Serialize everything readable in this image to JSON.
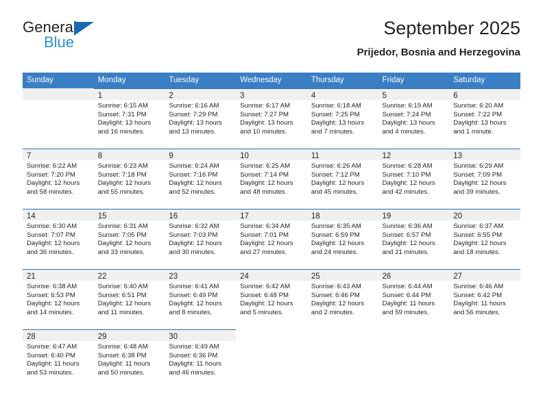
{
  "brand": {
    "line1": "General",
    "line2": "Blue",
    "triangle_color": "#1b68b3",
    "blue_text_color": "#2e8fd6"
  },
  "header": {
    "title": "September 2025",
    "subtitle": "Prijedor, Bosnia and Herzegovina",
    "header_bg_color": "#3a7ec4",
    "header_text_color": "#ffffff",
    "datebar_bg_color": "#f0f0f0",
    "rule_color": "#2f6fae"
  },
  "weekdays": [
    "Sunday",
    "Monday",
    "Tuesday",
    "Wednesday",
    "Thursday",
    "Friday",
    "Saturday"
  ],
  "weeks": [
    [
      {
        "day": "",
        "lines": []
      },
      {
        "day": "1",
        "lines": [
          "Sunrise: 6:15 AM",
          "Sunset: 7:31 PM",
          "Daylight: 13 hours",
          "and 16 minutes."
        ]
      },
      {
        "day": "2",
        "lines": [
          "Sunrise: 6:16 AM",
          "Sunset: 7:29 PM",
          "Daylight: 13 hours",
          "and 13 minutes."
        ]
      },
      {
        "day": "3",
        "lines": [
          "Sunrise: 6:17 AM",
          "Sunset: 7:27 PM",
          "Daylight: 13 hours",
          "and 10 minutes."
        ]
      },
      {
        "day": "4",
        "lines": [
          "Sunrise: 6:18 AM",
          "Sunset: 7:25 PM",
          "Daylight: 13 hours",
          "and 7 minutes."
        ]
      },
      {
        "day": "5",
        "lines": [
          "Sunrise: 6:19 AM",
          "Sunset: 7:24 PM",
          "Daylight: 13 hours",
          "and 4 minutes."
        ]
      },
      {
        "day": "6",
        "lines": [
          "Sunrise: 6:20 AM",
          "Sunset: 7:22 PM",
          "Daylight: 13 hours",
          "and 1 minute."
        ]
      }
    ],
    [
      {
        "day": "7",
        "lines": [
          "Sunrise: 6:22 AM",
          "Sunset: 7:20 PM",
          "Daylight: 12 hours",
          "and 58 minutes."
        ]
      },
      {
        "day": "8",
        "lines": [
          "Sunrise: 6:23 AM",
          "Sunset: 7:18 PM",
          "Daylight: 12 hours",
          "and 55 minutes."
        ]
      },
      {
        "day": "9",
        "lines": [
          "Sunrise: 6:24 AM",
          "Sunset: 7:16 PM",
          "Daylight: 12 hours",
          "and 52 minutes."
        ]
      },
      {
        "day": "10",
        "lines": [
          "Sunrise: 6:25 AM",
          "Sunset: 7:14 PM",
          "Daylight: 12 hours",
          "and 48 minutes."
        ]
      },
      {
        "day": "11",
        "lines": [
          "Sunrise: 6:26 AM",
          "Sunset: 7:12 PM",
          "Daylight: 12 hours",
          "and 45 minutes."
        ]
      },
      {
        "day": "12",
        "lines": [
          "Sunrise: 6:28 AM",
          "Sunset: 7:10 PM",
          "Daylight: 12 hours",
          "and 42 minutes."
        ]
      },
      {
        "day": "13",
        "lines": [
          "Sunrise: 6:29 AM",
          "Sunset: 7:09 PM",
          "Daylight: 12 hours",
          "and 39 minutes."
        ]
      }
    ],
    [
      {
        "day": "14",
        "lines": [
          "Sunrise: 6:30 AM",
          "Sunset: 7:07 PM",
          "Daylight: 12 hours",
          "and 36 minutes."
        ]
      },
      {
        "day": "15",
        "lines": [
          "Sunrise: 6:31 AM",
          "Sunset: 7:05 PM",
          "Daylight: 12 hours",
          "and 33 minutes."
        ]
      },
      {
        "day": "16",
        "lines": [
          "Sunrise: 6:32 AM",
          "Sunset: 7:03 PM",
          "Daylight: 12 hours",
          "and 30 minutes."
        ]
      },
      {
        "day": "17",
        "lines": [
          "Sunrise: 6:34 AM",
          "Sunset: 7:01 PM",
          "Daylight: 12 hours",
          "and 27 minutes."
        ]
      },
      {
        "day": "18",
        "lines": [
          "Sunrise: 6:35 AM",
          "Sunset: 6:59 PM",
          "Daylight: 12 hours",
          "and 24 minutes."
        ]
      },
      {
        "day": "19",
        "lines": [
          "Sunrise: 6:36 AM",
          "Sunset: 6:57 PM",
          "Daylight: 12 hours",
          "and 21 minutes."
        ]
      },
      {
        "day": "20",
        "lines": [
          "Sunrise: 6:37 AM",
          "Sunset: 6:55 PM",
          "Daylight: 12 hours",
          "and 18 minutes."
        ]
      }
    ],
    [
      {
        "day": "21",
        "lines": [
          "Sunrise: 6:38 AM",
          "Sunset: 6:53 PM",
          "Daylight: 12 hours",
          "and 14 minutes."
        ]
      },
      {
        "day": "22",
        "lines": [
          "Sunrise: 6:40 AM",
          "Sunset: 6:51 PM",
          "Daylight: 12 hours",
          "and 11 minutes."
        ]
      },
      {
        "day": "23",
        "lines": [
          "Sunrise: 6:41 AM",
          "Sunset: 6:49 PM",
          "Daylight: 12 hours",
          "and 8 minutes."
        ]
      },
      {
        "day": "24",
        "lines": [
          "Sunrise: 6:42 AM",
          "Sunset: 6:48 PM",
          "Daylight: 12 hours",
          "and 5 minutes."
        ]
      },
      {
        "day": "25",
        "lines": [
          "Sunrise: 6:43 AM",
          "Sunset: 6:46 PM",
          "Daylight: 12 hours",
          "and 2 minutes."
        ]
      },
      {
        "day": "26",
        "lines": [
          "Sunrise: 6:44 AM",
          "Sunset: 6:44 PM",
          "Daylight: 11 hours",
          "and 59 minutes."
        ]
      },
      {
        "day": "27",
        "lines": [
          "Sunrise: 6:46 AM",
          "Sunset: 6:42 PM",
          "Daylight: 11 hours",
          "and 56 minutes."
        ]
      }
    ],
    [
      {
        "day": "28",
        "lines": [
          "Sunrise: 6:47 AM",
          "Sunset: 6:40 PM",
          "Daylight: 11 hours",
          "and 53 minutes."
        ]
      },
      {
        "day": "29",
        "lines": [
          "Sunrise: 6:48 AM",
          "Sunset: 6:38 PM",
          "Daylight: 11 hours",
          "and 50 minutes."
        ]
      },
      {
        "day": "30",
        "lines": [
          "Sunrise: 6:49 AM",
          "Sunset: 6:36 PM",
          "Daylight: 11 hours",
          "and 46 minutes."
        ]
      },
      {
        "day": "",
        "lines": []
      },
      {
        "day": "",
        "lines": []
      },
      {
        "day": "",
        "lines": []
      },
      {
        "day": "",
        "lines": []
      }
    ]
  ]
}
